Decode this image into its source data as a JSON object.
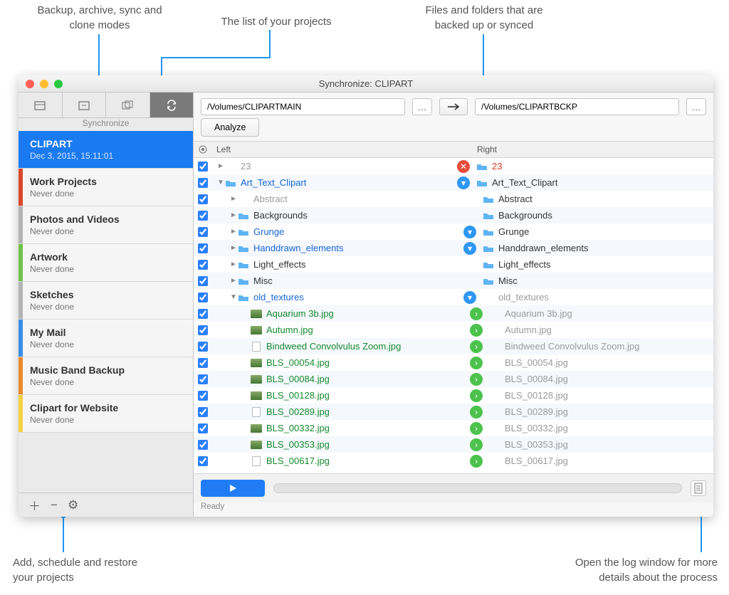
{
  "window": {
    "title": "Synchronize: CLIPART"
  },
  "annotations": {
    "modes": "Backup, archive, sync and\nclone modes",
    "projects": "The list of your projects",
    "files": "Files and folders that are\nbacked up or synced",
    "add": "Add, schedule and restore\nyour projects",
    "log": "Open the log window for more\ndetails about the process"
  },
  "sidebar": {
    "modeLabel": "Synchronize",
    "projects": [
      {
        "name": "CLIPART",
        "status": "Dec 3, 2015, 15:11:01",
        "color": "#1a7af2",
        "selected": true
      },
      {
        "name": "Work Projects",
        "status": "Never done",
        "color": "#d9482b"
      },
      {
        "name": "Photos and Videos",
        "status": "Never done",
        "color": "#b3b3b3"
      },
      {
        "name": "Artwork",
        "status": "Never done",
        "color": "#6fc24a"
      },
      {
        "name": "Sketches",
        "status": "Never done",
        "color": "#b3b3b3"
      },
      {
        "name": "My Mail",
        "status": "Never done",
        "color": "#3a8ee8"
      },
      {
        "name": "Music Band Backup",
        "status": "Never done",
        "color": "#ea8a2a"
      },
      {
        "name": "Clipart for Website",
        "status": "Never done",
        "color": "#f3d03e"
      }
    ]
  },
  "paths": {
    "left": "/Volumes/CLIPARTMAIN",
    "right": "/Volumes/CLIPARTBCKP",
    "analyze": "Analyze"
  },
  "headers": {
    "left": "Left",
    "right": "Right"
  },
  "rows": [
    {
      "cb": true,
      "l": {
        "indent": 0,
        "tri": "►",
        "ic": "",
        "txt": "23",
        "cls": "gray"
      },
      "badge": "del",
      "r": {
        "ic": "folder",
        "txt": "23",
        "cls": "red"
      }
    },
    {
      "cb": true,
      "l": {
        "indent": 0,
        "tri": "▼",
        "ic": "folder",
        "txt": "Art_Text_Clipart",
        "cls": "blue"
      },
      "badge": "down",
      "r": {
        "ic": "folder",
        "txt": "Art_Text_Clipart",
        "cls": "black"
      }
    },
    {
      "cb": true,
      "l": {
        "indent": 1,
        "tri": "►",
        "ic": "",
        "txt": "Abstract",
        "cls": "gray"
      },
      "badge": "",
      "r": {
        "ic": "folder",
        "txt": "Abstract",
        "cls": "black"
      }
    },
    {
      "cb": true,
      "l": {
        "indent": 1,
        "tri": "►",
        "ic": "folder",
        "txt": "Backgrounds",
        "cls": "black"
      },
      "badge": "",
      "r": {
        "ic": "folder",
        "txt": "Backgrounds",
        "cls": "black"
      }
    },
    {
      "cb": true,
      "l": {
        "indent": 1,
        "tri": "►",
        "ic": "folder",
        "txt": "Grunge",
        "cls": "blue"
      },
      "badge": "down",
      "r": {
        "ic": "folder",
        "txt": "Grunge",
        "cls": "black"
      }
    },
    {
      "cb": true,
      "l": {
        "indent": 1,
        "tri": "►",
        "ic": "folder",
        "txt": "Handdrawn_elements",
        "cls": "blue"
      },
      "badge": "down",
      "r": {
        "ic": "folder",
        "txt": "Handdrawn_elements",
        "cls": "black"
      }
    },
    {
      "cb": true,
      "l": {
        "indent": 1,
        "tri": "►",
        "ic": "folder",
        "txt": "Light_effects",
        "cls": "black"
      },
      "badge": "",
      "r": {
        "ic": "folder",
        "txt": "Light_effects",
        "cls": "black"
      }
    },
    {
      "cb": true,
      "l": {
        "indent": 1,
        "tri": "►",
        "ic": "folder",
        "txt": "Misc",
        "cls": "black"
      },
      "badge": "",
      "r": {
        "ic": "folder",
        "txt": "Misc",
        "cls": "black"
      }
    },
    {
      "cb": true,
      "l": {
        "indent": 1,
        "tri": "▼",
        "ic": "folder",
        "txt": "old_textures",
        "cls": "blue"
      },
      "badge": "down",
      "r": {
        "ic": "",
        "txt": "old_textures",
        "cls": "gray"
      }
    },
    {
      "cb": true,
      "l": {
        "indent": 2,
        "tri": "",
        "ic": "thumb",
        "txt": "Aquarium 3b.jpg",
        "cls": "green"
      },
      "badge": "right",
      "r": {
        "ic": "",
        "txt": "Aquarium 3b.jpg",
        "cls": "gray"
      }
    },
    {
      "cb": true,
      "l": {
        "indent": 2,
        "tri": "",
        "ic": "thumb",
        "txt": "Autumn.jpg",
        "cls": "green"
      },
      "badge": "right",
      "r": {
        "ic": "",
        "txt": "Autumn.jpg",
        "cls": "gray"
      }
    },
    {
      "cb": true,
      "l": {
        "indent": 2,
        "tri": "",
        "ic": "doc",
        "txt": "Bindweed Convolvulus Zoom.jpg",
        "cls": "green"
      },
      "badge": "right",
      "r": {
        "ic": "",
        "txt": "Bindweed Convolvulus Zoom.jpg",
        "cls": "gray"
      }
    },
    {
      "cb": true,
      "l": {
        "indent": 2,
        "tri": "",
        "ic": "thumb",
        "txt": "BLS_00054.jpg",
        "cls": "green"
      },
      "badge": "right",
      "r": {
        "ic": "",
        "txt": "BLS_00054.jpg",
        "cls": "gray"
      }
    },
    {
      "cb": true,
      "l": {
        "indent": 2,
        "tri": "",
        "ic": "thumb",
        "txt": "BLS_00084.jpg",
        "cls": "green"
      },
      "badge": "right",
      "r": {
        "ic": "",
        "txt": "BLS_00084.jpg",
        "cls": "gray"
      }
    },
    {
      "cb": true,
      "l": {
        "indent": 2,
        "tri": "",
        "ic": "thumb",
        "txt": "BLS_00128.jpg",
        "cls": "green"
      },
      "badge": "right",
      "r": {
        "ic": "",
        "txt": "BLS_00128.jpg",
        "cls": "gray"
      }
    },
    {
      "cb": true,
      "l": {
        "indent": 2,
        "tri": "",
        "ic": "doc",
        "txt": "BLS_00289.jpg",
        "cls": "green"
      },
      "badge": "right",
      "r": {
        "ic": "",
        "txt": "BLS_00289.jpg",
        "cls": "gray"
      }
    },
    {
      "cb": true,
      "l": {
        "indent": 2,
        "tri": "",
        "ic": "thumb",
        "txt": "BLS_00332.jpg",
        "cls": "green"
      },
      "badge": "right",
      "r": {
        "ic": "",
        "txt": "BLS_00332.jpg",
        "cls": "gray"
      }
    },
    {
      "cb": true,
      "l": {
        "indent": 2,
        "tri": "",
        "ic": "thumb",
        "txt": "BLS_00353.jpg",
        "cls": "green"
      },
      "badge": "right",
      "r": {
        "ic": "",
        "txt": "BLS_00353.jpg",
        "cls": "gray"
      }
    },
    {
      "cb": true,
      "l": {
        "indent": 2,
        "tri": "",
        "ic": "doc",
        "txt": "BLS_00617.jpg",
        "cls": "green"
      },
      "badge": "right",
      "r": {
        "ic": "",
        "txt": "BLS_00617.jpg",
        "cls": "gray"
      }
    }
  ],
  "footer": {
    "ready": "Ready"
  }
}
